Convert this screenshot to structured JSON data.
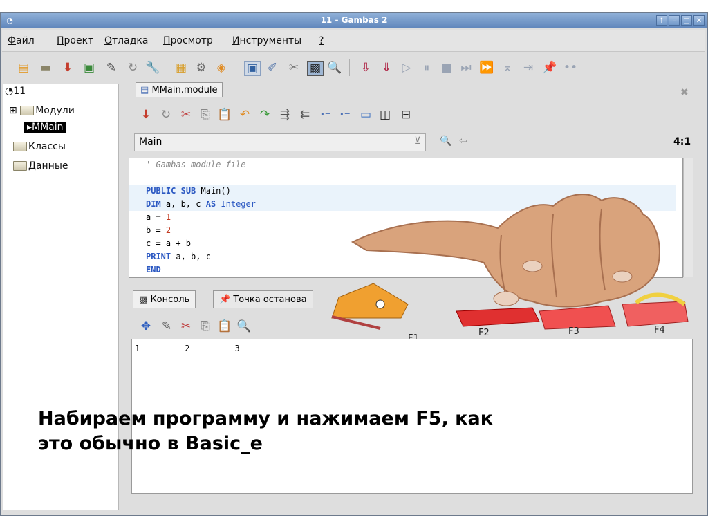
{
  "window": {
    "title": "11 - Gambas 2"
  },
  "menu": [
    {
      "u": "Ф",
      "rest": "айл"
    },
    {
      "u": "П",
      "rest": "роект"
    },
    {
      "u": "О",
      "rest": "тладка"
    },
    {
      "u": "П",
      "rest": "росмотр"
    },
    {
      "u": "И",
      "rest": "нструменты"
    },
    {
      "u": "?",
      "rest": ""
    }
  ],
  "tree": {
    "root": "11",
    "modules_label": "Модули",
    "module_item": "MMain",
    "classes_label": "Классы",
    "data_label": "Данные"
  },
  "editor": {
    "tab": "MMain.module",
    "procedure": "Main",
    "position": "4:1",
    "code": {
      "comment": "' Gambas module file",
      "l1_kw1": "PUBLIC",
      "l1_kw2": "SUB",
      "l1_rest": " Main()",
      "l2_kw": "DIM",
      "l2_rest": " a, b, c ",
      "l2_kw2": "AS",
      "l2_type": " Integer",
      "l3_a": "a = ",
      "l3_n": "1",
      "l4_a": "b = ",
      "l4_n": "2",
      "l5": "c = a + b",
      "l6_kw": "PRINT",
      "l6_rest": " a, b, c",
      "l7_kw": "END"
    }
  },
  "bottom_tabs": {
    "console": "Консоль",
    "breakpoint": "Точка останова"
  },
  "console": {
    "output": "1         2         3"
  },
  "overlay": {
    "line1": "Набираем программу и нажимаем F5, как",
    "line2": "это обычно в Basic_е"
  },
  "fkeys": [
    "F1",
    "F2",
    "F3",
    "F4"
  ]
}
